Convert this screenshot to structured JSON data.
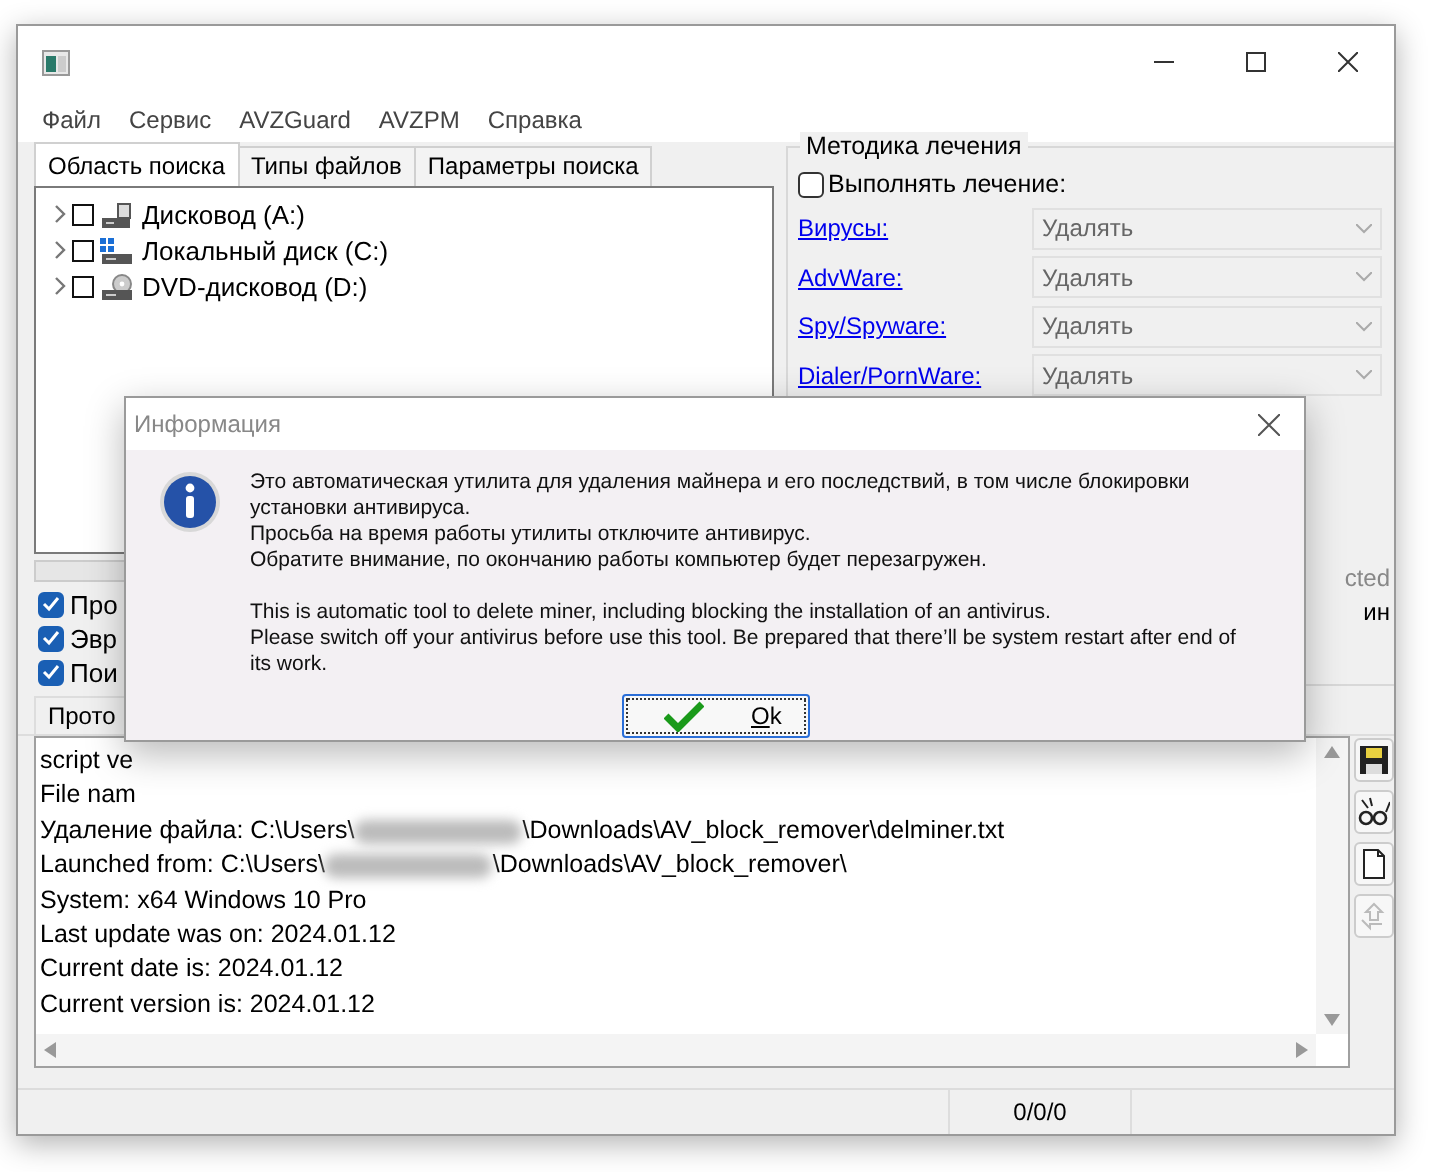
{
  "menu": [
    "Файл",
    "Сервис",
    "AVZGuard",
    "AVZPM",
    "Справка"
  ],
  "tabs": [
    {
      "label": "Область поиска",
      "selected": true
    },
    {
      "label": "Типы файлов",
      "selected": false
    },
    {
      "label": "Параметры поиска",
      "selected": false
    }
  ],
  "tree": [
    {
      "label": "Дисковод (A:)",
      "kind": "floppy",
      "checked": false
    },
    {
      "label": "Локальный диск (C:)",
      "kind": "system",
      "checked": false
    },
    {
      "label": "DVD-дисковод (D:)",
      "kind": "dvd",
      "checked": false
    }
  ],
  "cure": {
    "title": "Методика лечения",
    "perform": {
      "label": "Выполнять лечение:",
      "checked": false
    },
    "rows": [
      {
        "label": "Вирусы:",
        "value": "Удалять"
      },
      {
        "label": "AdvWare:",
        "value": "Удалять"
      },
      {
        "label": "Spy/Spyware:",
        "value": "Удалять"
      },
      {
        "label": "Dialer/PornWare:",
        "value": "Удалять"
      }
    ]
  },
  "options": [
    {
      "label": "Про",
      "checked": true
    },
    {
      "label": "Эвр",
      "checked": true
    },
    {
      "label": "Пои",
      "checked": true
    }
  ],
  "right_texts": [
    "cted",
    "ин"
  ],
  "log_tab": "Прото",
  "log": [
    {
      "text": "script ve"
    },
    {
      "text": "File nam"
    },
    {
      "before": "Удаление файла: C:\\Users\\",
      "after": "\\Downloads\\AV_block_remover\\delminer.txt"
    },
    {
      "before": "Launched from: C:\\Users\\",
      "after": "\\Downloads\\AV_block_remover\\"
    },
    {
      "text": "System: x64 Windows 10 Pro"
    },
    {
      "text": "Last update was on: 2024.01.12"
    },
    {
      "text": "Current date is: 2024.01.12"
    },
    {
      "text": "Current version is: 2024.01.12"
    }
  ],
  "status": "0/0/0",
  "dialog": {
    "title": "Информация",
    "ru": [
      "Это автоматическая утилита для удаления майнера и его последствий, в том числе блокировки установки антивируса.",
      "Просьба на время работы утилиты отключите антивирус.",
      "Обратите внимание, по окончанию работы компьютер будет перезагружен."
    ],
    "en": [
      "This is automatic tool to delete miner, including blocking the installation of an antivirus.",
      "Please switch off your antivirus before use this tool. Be prepared that there’ll be system restart after end of its work."
    ],
    "button": "Ok"
  }
}
